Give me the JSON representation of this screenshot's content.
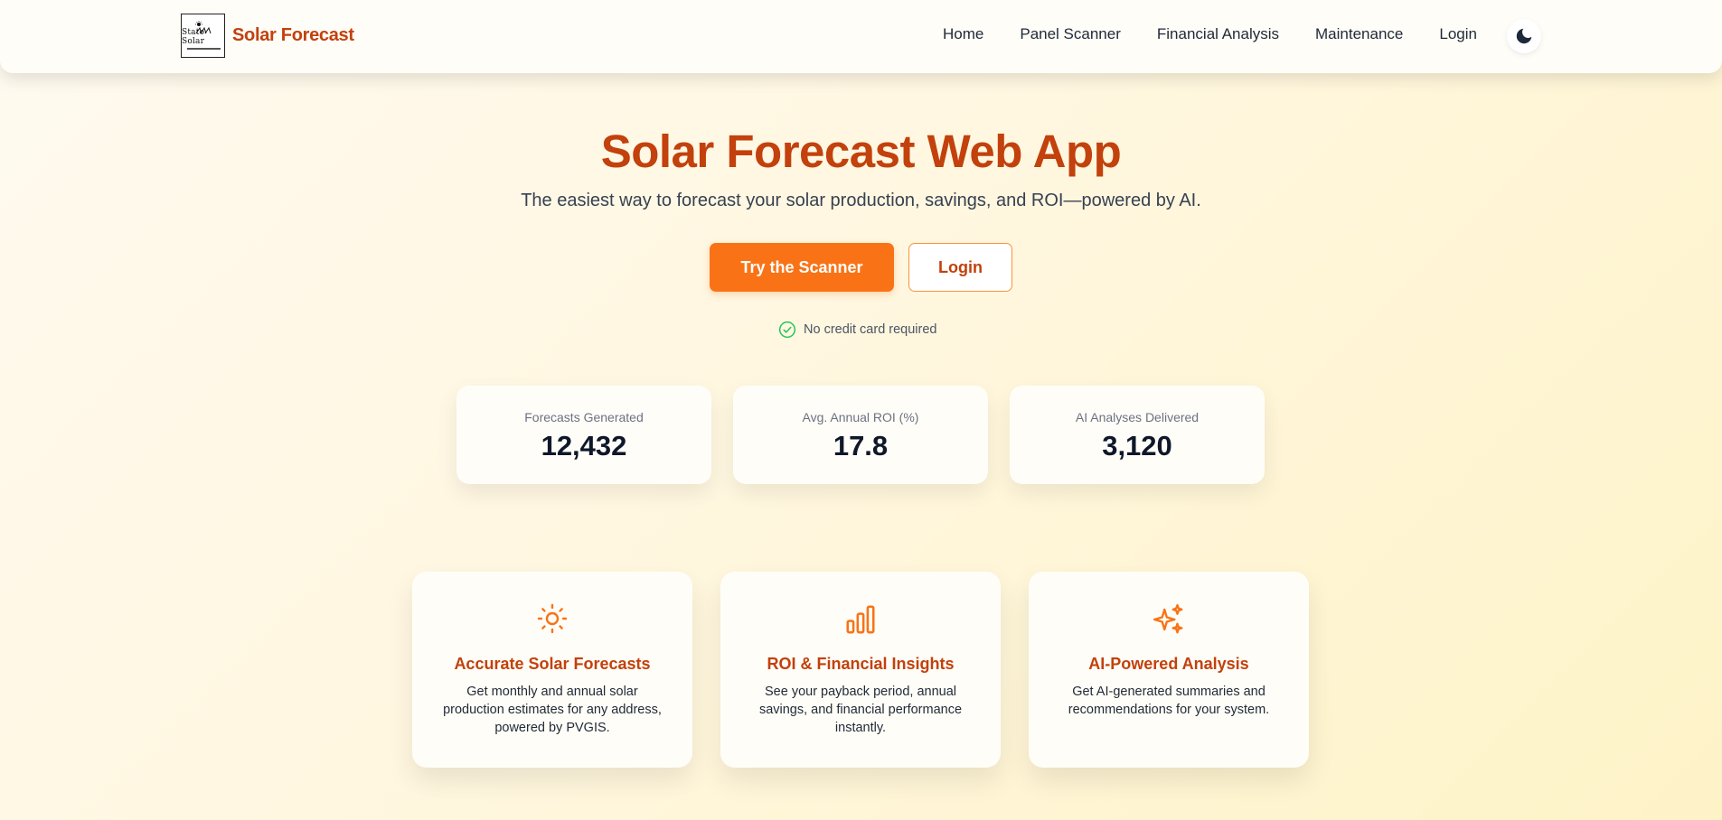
{
  "brand": {
    "name": "Solar Forecast",
    "logo_text": "Stato Solar"
  },
  "nav": {
    "links": [
      "Home",
      "Panel Scanner",
      "Financial Analysis",
      "Maintenance",
      "Login"
    ],
    "theme_icon": "moon-icon"
  },
  "hero": {
    "title": "Solar Forecast Web App",
    "subtitle": "The easiest way to forecast your solar production, savings, and ROI—powered by AI.",
    "primary_cta": "Try the Scanner",
    "secondary_cta": "Login",
    "note": "No credit card required"
  },
  "stats": [
    {
      "label": "Forecasts Generated",
      "value": "12,432"
    },
    {
      "label": "Avg. Annual ROI (%)",
      "value": "17.8"
    },
    {
      "label": "AI Analyses Delivered",
      "value": "3,120"
    }
  ],
  "features": [
    {
      "icon": "sun-icon",
      "title": "Accurate Solar Forecasts",
      "desc": "Get monthly and annual solar production estimates for any address, powered by PVGIS."
    },
    {
      "icon": "bar-chart-icon",
      "title": "ROI & Financial Insights",
      "desc": "See your payback period, annual savings, and financial performance instantly."
    },
    {
      "icon": "sparkles-icon",
      "title": "AI-Powered Analysis",
      "desc": "Get AI-generated summaries and recommendations for your system."
    }
  ],
  "colors": {
    "accent": "#f97316",
    "brand": "#c2410c",
    "success": "#22c55e"
  }
}
